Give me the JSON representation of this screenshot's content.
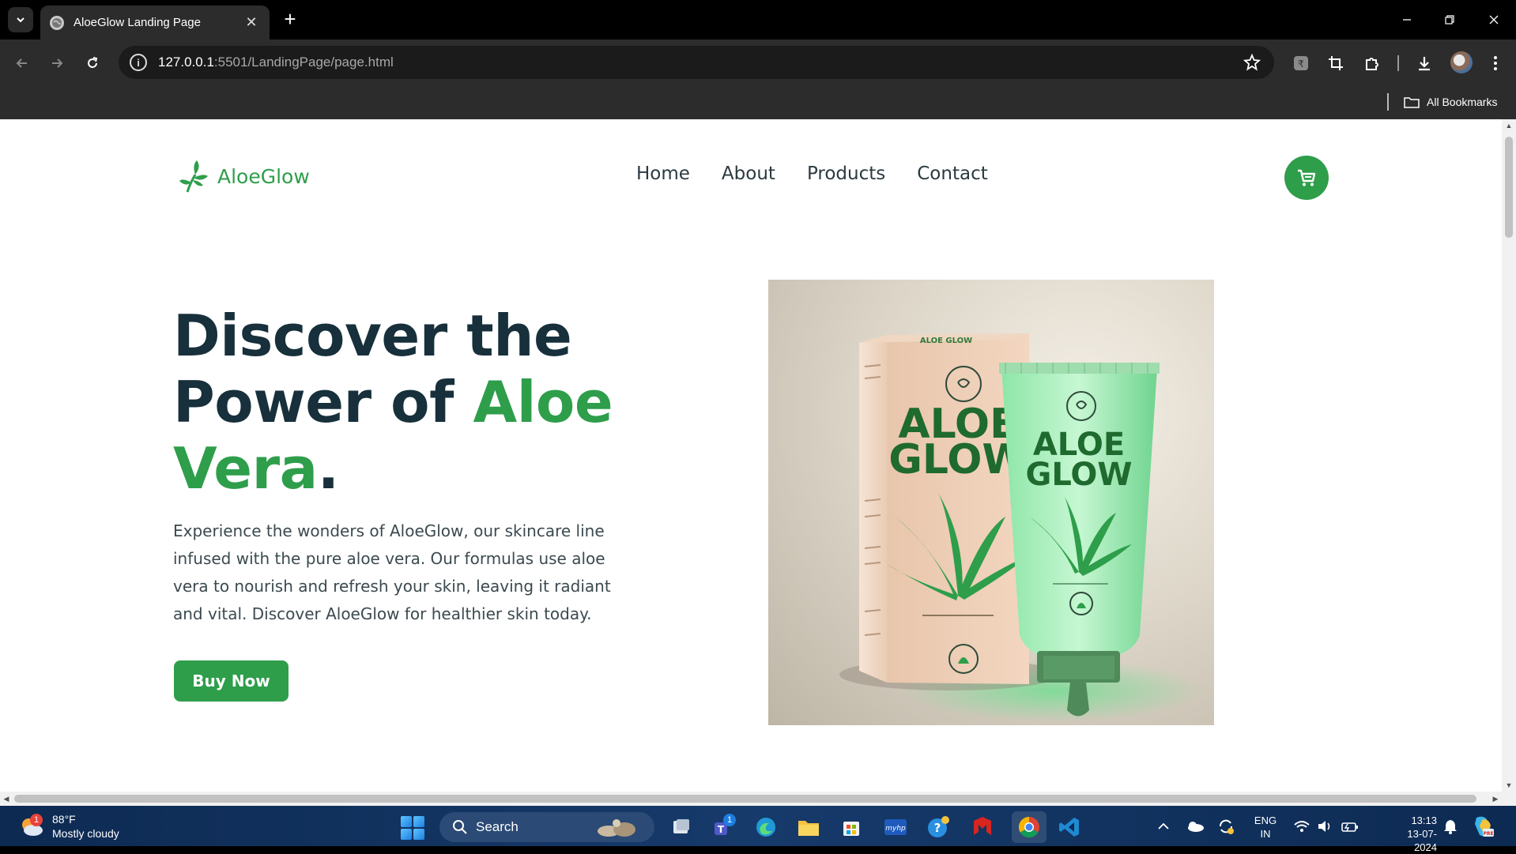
{
  "browser": {
    "tab_title": "AloeGlow Landing Page",
    "url_host": "127.0.0.1",
    "url_path": ":5501/LandingPage/page.html",
    "bookmarks_label": "All Bookmarks"
  },
  "site": {
    "logo_text": "AloeGlow",
    "nav": [
      "Home",
      "About",
      "Products",
      "Contact"
    ],
    "hero": {
      "title_part1": "Discover the Power of ",
      "title_accent": "Aloe Vera",
      "title_end": ".",
      "description": "Experience the wonders of AloeGlow, our skincare line infused with the pure aloe vera. Our formulas use aloe vera to nourish and refresh your skin, leaving it radiant and vital. Discover AloeGlow for healthier skin today.",
      "button": "Buy Now"
    },
    "product_image": {
      "box_brand": "ALOE GLOW",
      "box_top": "ALOE GLOW",
      "tube_brand_line1": "ALOE",
      "tube_brand_line2": "GLOW",
      "box_brand_line1": "ALOE",
      "box_brand_line2": "GLOW"
    }
  },
  "colors": {
    "brand_green": "#2e9e4b",
    "heading_dark": "#17303b"
  },
  "taskbar": {
    "weather_temp": "88°F",
    "weather_desc": "Mostly cloudy",
    "weather_badge": "1",
    "search_label": "Search",
    "teams_badge": "1",
    "lang_line1": "ENG",
    "lang_line2": "IN",
    "time": "13:13",
    "date": "13-07-2024"
  }
}
